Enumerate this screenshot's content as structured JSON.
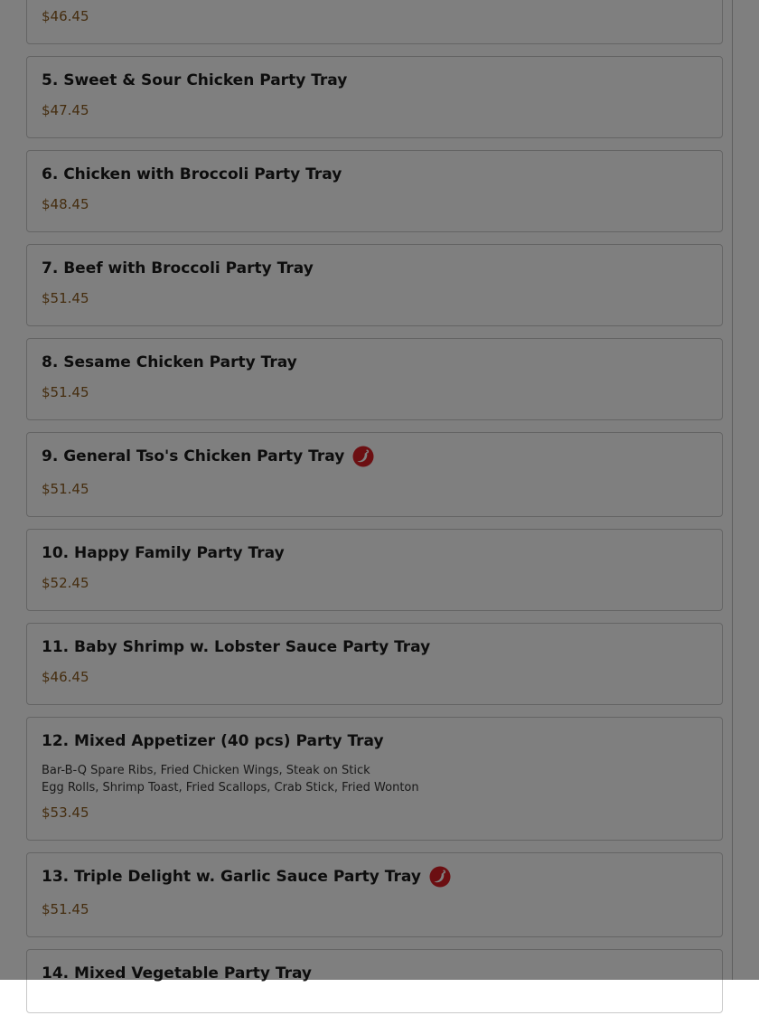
{
  "items": [
    {
      "name": "",
      "price": "$46.45",
      "spicy": false,
      "description": []
    },
    {
      "name": "5. Sweet & Sour Chicken Party Tray",
      "price": "$47.45",
      "spicy": false,
      "description": []
    },
    {
      "name": "6. Chicken with Broccoli Party Tray",
      "price": "$48.45",
      "spicy": false,
      "description": []
    },
    {
      "name": "7. Beef with Broccoli Party Tray",
      "price": "$51.45",
      "spicy": false,
      "description": []
    },
    {
      "name": "8. Sesame Chicken Party Tray",
      "price": "$51.45",
      "spicy": false,
      "description": []
    },
    {
      "name": "9. General Tso's Chicken Party Tray",
      "price": "$51.45",
      "spicy": true,
      "description": []
    },
    {
      "name": "10. Happy Family Party Tray",
      "price": "$52.45",
      "spicy": false,
      "description": []
    },
    {
      "name": "11. Baby Shrimp w. Lobster Sauce Party Tray",
      "price": "$46.45",
      "spicy": false,
      "description": []
    },
    {
      "name": "12. Mixed Appetizer (40 pcs) Party Tray",
      "price": "$53.45",
      "spicy": false,
      "description": [
        "Bar-B-Q Spare Ribs, Fried Chicken Wings, Steak on Stick",
        "Egg Rolls, Shrimp Toast, Fried Scallops, Crab Stick, Fried Wonton"
      ]
    },
    {
      "name": "13. Triple Delight w. Garlic Sauce Party Tray",
      "price": "$51.45",
      "spicy": true,
      "description": []
    },
    {
      "name": "14. Mixed Vegetable Party Tray",
      "price": "",
      "spicy": false,
      "description": []
    }
  ],
  "colors": {
    "price": "#8a5a1f",
    "spicy_icon": "#c0171c",
    "overlay": "rgba(0,0,0,0.5)"
  },
  "icons": {
    "spicy": "chili-pepper-icon"
  }
}
